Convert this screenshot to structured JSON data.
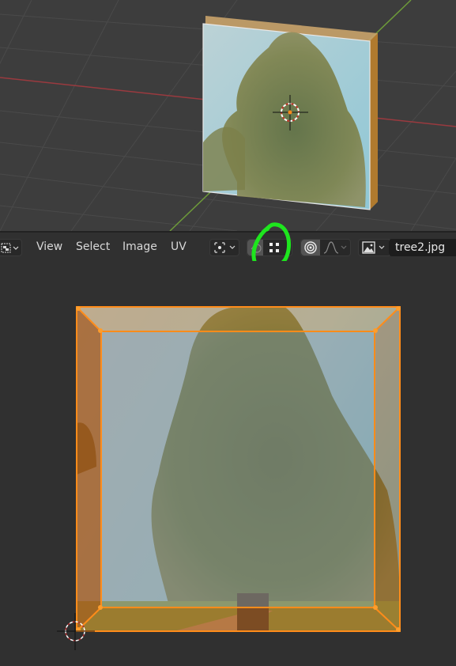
{
  "viewport3d": {
    "object": "textured-cube",
    "axis_colors": {
      "x": "#9a3a3f",
      "y": "#6d9a3a"
    },
    "selection_color": "#ff8c1a"
  },
  "header": {
    "menus": [
      "View",
      "Select",
      "Image",
      "UV"
    ],
    "editor_type_icon": "uv-editor-icon",
    "pivot_icon": "pivot-point-icon",
    "sticky_mode_icon": "sticky-selection-icon",
    "selection_mode_icon": "vertex-select-icon",
    "proportional_icon": "proportional-editing-icon",
    "falloff_icon": "falloff-curve-icon",
    "image_browse_icon": "image-browse-icon",
    "image_name": "tree2.jpg",
    "annotation_color": "#1ee61e"
  },
  "uv_editor": {
    "image": "tree2.jpg",
    "edge_color": "#ff8c1a",
    "vertex_color": "#ff9d2b"
  }
}
